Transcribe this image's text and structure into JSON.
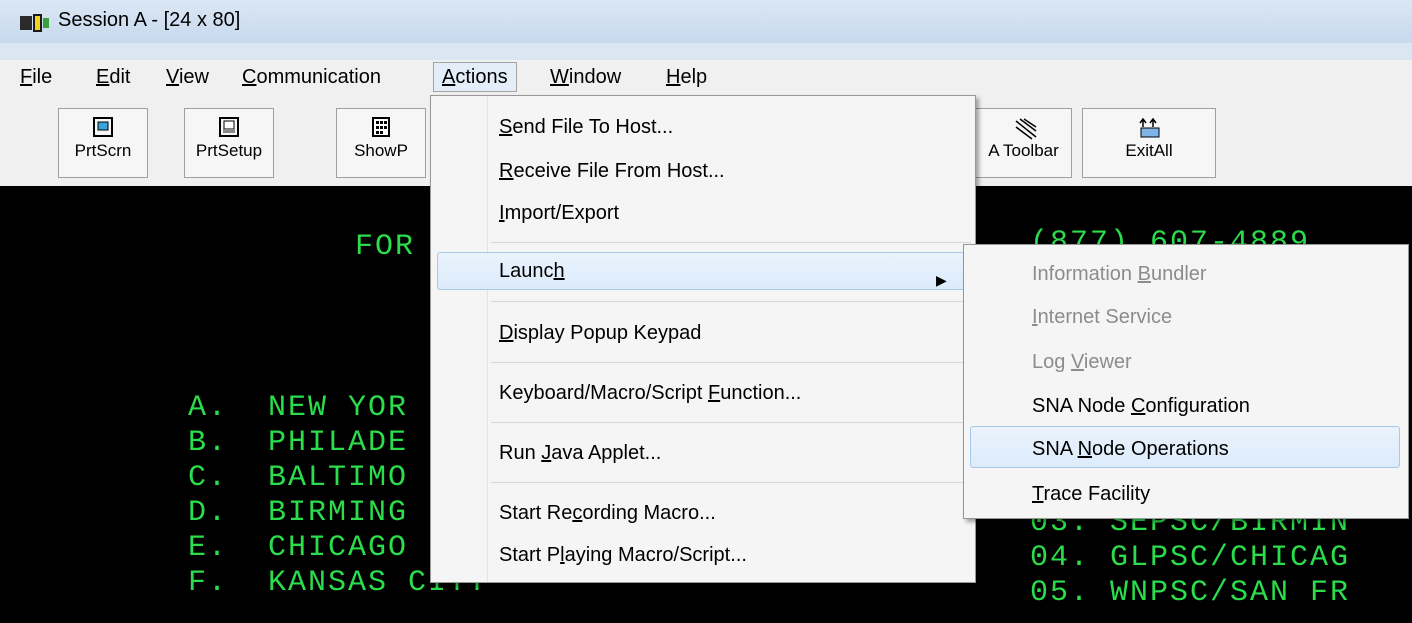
{
  "window": {
    "title": "Session A - [24 x 80]"
  },
  "menubar": {
    "items": [
      {
        "pre": "",
        "acc": "F",
        "post": "ile"
      },
      {
        "pre": "",
        "acc": "E",
        "post": "dit"
      },
      {
        "pre": "",
        "acc": "V",
        "post": "iew"
      },
      {
        "pre": "",
        "acc": "C",
        "post": "ommunication"
      },
      {
        "pre": "",
        "acc": "A",
        "post": "ctions"
      },
      {
        "pre": "",
        "acc": "W",
        "post": "indow"
      },
      {
        "pre": "",
        "acc": "H",
        "post": "elp"
      }
    ]
  },
  "toolbar": {
    "buttons": [
      {
        "label": "PrtScrn",
        "icon": "print-screen-icon"
      },
      {
        "label": "PrtSetup",
        "icon": "printer-setup-icon"
      },
      {
        "label": "ShowP",
        "icon": "keypad-icon"
      },
      {
        "label": "A Toolbar",
        "icon": "toolbar-icon"
      },
      {
        "label": "ExitAll",
        "icon": "exit-all-icon"
      }
    ]
  },
  "terminal": {
    "color": "#2bdc4b",
    "lines": [
      "FOR",
      "A.  NEW YOR",
      "B.  PHILADE",
      "C.  BALTIMO",
      "D.  BIRMING",
      "E.  CHICAGO",
      "F.  KANSAS CITY"
    ],
    "right_lines": [
      "(877) 607-4889",
      "03. SEPSC/BIRMIN",
      "04. GLPSC/CHICAG",
      "05. WNPSC/SAN FR"
    ]
  },
  "actions_menu": {
    "items": [
      {
        "pre": "",
        "acc": "S",
        "post": "end File To Host..."
      },
      {
        "pre": "",
        "acc": "R",
        "post": "eceive File From Host..."
      },
      {
        "pre": "",
        "acc": "I",
        "post": "mport/Export"
      },
      {
        "pre": "Launc",
        "acc": "h",
        "post": ""
      },
      {
        "pre": "",
        "acc": "D",
        "post": "isplay Popup Keypad"
      },
      {
        "pre": "Keyboard/Macro/Script ",
        "acc": "F",
        "post": "unction..."
      },
      {
        "pre": "Run ",
        "acc": "J",
        "post": "ava Applet..."
      },
      {
        "pre": "Start Re",
        "acc": "c",
        "post": "ording Macro..."
      },
      {
        "pre": "Start P",
        "acc": "l",
        "post": "aying Macro/Script..."
      }
    ]
  },
  "launch_submenu": {
    "items": [
      {
        "pre": "Information ",
        "acc": "B",
        "post": "undler",
        "disabled": true
      },
      {
        "pre": "",
        "acc": "I",
        "post": "nternet Service",
        "disabled": true
      },
      {
        "pre": "Log ",
        "acc": "V",
        "post": "iewer",
        "disabled": true
      },
      {
        "pre": "SNA Node ",
        "acc": "C",
        "post": "onfiguration",
        "disabled": false
      },
      {
        "pre": "SNA ",
        "acc": "N",
        "post": "ode Operations",
        "disabled": false
      },
      {
        "pre": "",
        "acc": "T",
        "post": "race Facility",
        "disabled": false
      }
    ]
  }
}
